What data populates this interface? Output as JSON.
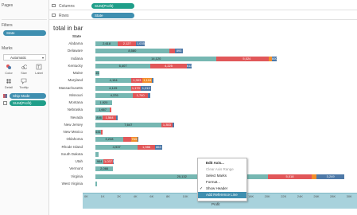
{
  "sidebar": {
    "pages_title": "Pages",
    "filters_title": "Filters",
    "filter_pill": "State",
    "marks_title": "Marks",
    "marks_type": "Automatic",
    "mark_buttons": [
      "Color",
      "Size",
      "Label",
      "Detail",
      "Tooltip"
    ],
    "mark_pills": [
      "Ship Mode",
      "SUM(Profit)"
    ]
  },
  "shelves": {
    "columns_label": "Columns",
    "columns_pill": "SUM(Profit)",
    "rows_label": "Rows",
    "rows_pill": "State"
  },
  "sheet": {
    "title": "total in bar",
    "row_header": "State"
  },
  "axis": {
    "label": "Profit",
    "ticks": [
      "0K",
      "1K",
      "2K",
      "4K",
      "6K",
      "8K",
      "10K",
      "12K",
      "14K",
      "16K",
      "18K",
      "20K",
      "22K",
      "24K",
      "26K",
      "28K",
      "30K"
    ]
  },
  "colors": {
    "teal": "#76b7b2",
    "red": "#e15759",
    "orange": "#f28e2b",
    "blue": "#4e79a7"
  },
  "chart_data": {
    "type": "bar",
    "stacked": true,
    "series_hint": "Ship Mode (colors)",
    "rows": [
      {
        "state": "Alabama",
        "segments": [
          {
            "c": "teal",
            "v": 2618,
            "label": "2,618"
          },
          {
            "c": "red",
            "v": 2127,
            "label": "2,127"
          },
          {
            "c": "blue",
            "v": 1035,
            "label": "1,035"
          }
        ]
      },
      {
        "state": "Delaware",
        "segments": [
          {
            "c": "teal",
            "v": 8580,
            "label": "8,580"
          },
          {
            "c": "red",
            "v": 700,
            "label": ""
          },
          {
            "c": "blue",
            "v": 893,
            "label": "893"
          }
        ]
      },
      {
        "state": "Indiana",
        "segments": [
          {
            "c": "teal",
            "v": 14120,
            "label": "14,120"
          },
          {
            "c": "red",
            "v": 1000,
            "label": ""
          },
          {
            "c": "red",
            "v": 5024,
            "label": "5,024"
          },
          {
            "c": "orange",
            "v": 400,
            "label": ""
          },
          {
            "c": "blue",
            "v": 600,
            "label": "600"
          }
        ]
      },
      {
        "state": "Kentucky",
        "segments": [
          {
            "c": "teal",
            "v": 6407,
            "label": "6,407"
          },
          {
            "c": "red",
            "v": 4225,
            "label": "4,225"
          },
          {
            "c": "blue",
            "v": 612,
            "label": "612"
          }
        ]
      },
      {
        "state": "Maine",
        "segments": [
          {
            "c": "teal",
            "v": 454,
            "label": "454"
          }
        ]
      },
      {
        "state": "Maryland",
        "segments": [
          {
            "c": "teal",
            "v": 4194,
            "label": "4,194"
          },
          {
            "c": "red",
            "v": 1303,
            "label": "1,303"
          },
          {
            "c": "orange",
            "v": 1104,
            "label": "1,104"
          },
          {
            "c": "blue",
            "v": 200,
            "label": ""
          }
        ]
      },
      {
        "state": "Massachusetts",
        "segments": [
          {
            "c": "teal",
            "v": 4129,
            "label": "4,129"
          },
          {
            "c": "red",
            "v": 1170,
            "label": "1,170"
          },
          {
            "c": "blue",
            "v": 1213,
            "label": "1,213"
          }
        ]
      },
      {
        "state": "Missouri",
        "segments": [
          {
            "c": "teal",
            "v": 4376,
            "label": "4,376"
          },
          {
            "c": "red",
            "v": 1740,
            "label": "1,740"
          },
          {
            "c": "blue",
            "v": 250,
            "label": ""
          }
        ]
      },
      {
        "state": "Montana",
        "segments": [
          {
            "c": "teal",
            "v": 1920,
            "label": "1,920"
          }
        ]
      },
      {
        "state": "Nebraska",
        "segments": [
          {
            "c": "teal",
            "v": 1667,
            "label": "1,667"
          },
          {
            "c": "red",
            "v": 200,
            "label": ""
          }
        ]
      },
      {
        "state": "Nevada",
        "segments": [
          {
            "c": "teal",
            "v": 846,
            "label": "846"
          },
          {
            "c": "red",
            "v": 1564,
            "label": "1,564"
          },
          {
            "c": "blue",
            "v": 150,
            "label": ""
          }
        ]
      },
      {
        "state": "New Jersey",
        "segments": [
          {
            "c": "teal",
            "v": 7647,
            "label": "7,647"
          },
          {
            "c": "red",
            "v": 1353,
            "label": "1,353"
          },
          {
            "c": "blue",
            "v": 150,
            "label": ""
          }
        ]
      },
      {
        "state": "New Mexico",
        "segments": [
          {
            "c": "teal",
            "v": 641,
            "label": "641"
          },
          {
            "c": "red",
            "v": 150,
            "label": ""
          }
        ]
      },
      {
        "state": "Oklahoma",
        "segments": [
          {
            "c": "teal",
            "v": 3228,
            "label": "3,228"
          },
          {
            "c": "red",
            "v": 900,
            "label": ""
          },
          {
            "c": "orange",
            "v": 763,
            "label": "763"
          },
          {
            "c": "blue",
            "v": 150,
            "label": ""
          }
        ]
      },
      {
        "state": "Rhode Island",
        "segments": [
          {
            "c": "teal",
            "v": 4937,
            "label": "4,937"
          },
          {
            "c": "red",
            "v": 1986,
            "label": "1,986"
          },
          {
            "c": "blue",
            "v": 863,
            "label": "863"
          }
        ]
      },
      {
        "state": "South Dakota",
        "segments": [
          {
            "c": "teal",
            "v": 395,
            "label": ""
          }
        ]
      },
      {
        "state": "Utah",
        "segments": [
          {
            "c": "teal",
            "v": 964,
            "label": "964"
          },
          {
            "c": "red",
            "v": 1037,
            "label": "1,037"
          },
          {
            "c": "blue",
            "v": 135,
            "label": "135"
          }
        ]
      },
      {
        "state": "Vermont",
        "segments": [
          {
            "c": "teal",
            "v": 2066,
            "label": "2,066"
          }
        ]
      },
      {
        "state": "Virginia",
        "segments": [
          {
            "c": "teal",
            "v": 20132,
            "label": "20,132"
          },
          {
            "c": "red",
            "v": 5018,
            "label": "5,018"
          },
          {
            "c": "orange",
            "v": 600,
            "label": ""
          },
          {
            "c": "blue",
            "v": 3249,
            "label": "3,249"
          }
        ]
      },
      {
        "state": "West Virginia",
        "segments": [
          {
            "c": "teal",
            "v": 200,
            "label": ""
          }
        ]
      }
    ],
    "xlim": [
      0,
      31000
    ],
    "xlabel": "Profit",
    "ylabel": "State"
  },
  "context_menu": {
    "items": [
      {
        "label": "Edit Axis...",
        "style": "bold"
      },
      {
        "label": "Clear Axis Range",
        "style": "dis"
      },
      {
        "label": "Select Marks",
        "style": ""
      },
      {
        "label": "Format...",
        "style": ""
      },
      {
        "label": "Show Header",
        "style": "check"
      },
      {
        "label": "Add Reference Line",
        "style": "hl"
      }
    ]
  }
}
